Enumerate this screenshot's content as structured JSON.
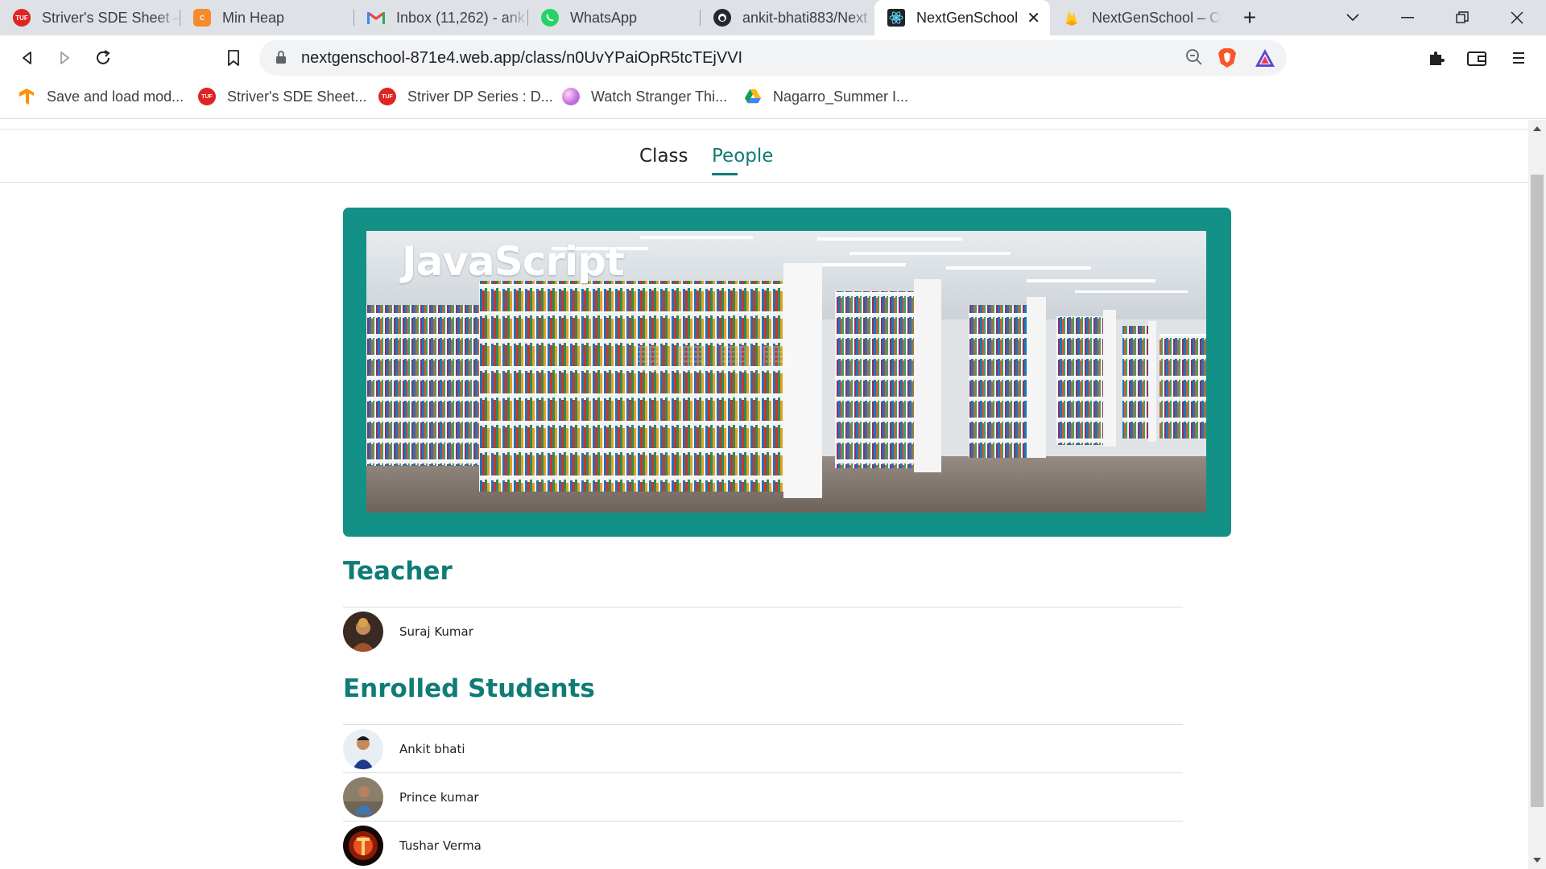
{
  "browser": {
    "tabs": [
      {
        "title": "Striver's SDE Sheet –",
        "icon": "tuf-icon"
      },
      {
        "title": "Min Heap",
        "icon": "codestudio-icon"
      },
      {
        "title": "Inbox (11,262) - ank",
        "icon": "gmail-icon"
      },
      {
        "title": "WhatsApp",
        "icon": "whatsapp-icon"
      },
      {
        "title": "ankit-bhati883/Next",
        "icon": "github-icon"
      },
      {
        "title": "NextGenSchool",
        "icon": "react-icon",
        "active": true
      },
      {
        "title": "NextGenSchool – Cl",
        "icon": "firebase-icon"
      }
    ],
    "url": "nextgenschool-871e4.web.app/class/n0UvYPaiOpR5tcTEjVVI",
    "bookmarks": [
      {
        "label": "Save and load mod...",
        "icon": "tensorflow-icon"
      },
      {
        "label": "Striver's SDE Sheet...",
        "icon": "tuf-icon"
      },
      {
        "label": "Striver DP Series : D...",
        "icon": "tuf-icon"
      },
      {
        "label": "Watch Stranger Thi...",
        "icon": "gradient-orb-icon"
      },
      {
        "label": "Nagarro_Summer I...",
        "icon": "google-drive-icon"
      }
    ]
  },
  "page": {
    "tabs": [
      {
        "label": "Class",
        "active": false
      },
      {
        "label": "People",
        "active": true
      }
    ],
    "class_name": "JavaScript",
    "teacher_heading": "Teacher",
    "teacher": {
      "name": "Suraj Kumar"
    },
    "students_heading": "Enrolled Students",
    "students": [
      {
        "name": "Ankit bhati"
      },
      {
        "name": "Prince kumar"
      },
      {
        "name": "Tushar Verma"
      }
    ]
  },
  "colors": {
    "accent": "#0f7c75",
    "banner_frame": "#139187"
  }
}
